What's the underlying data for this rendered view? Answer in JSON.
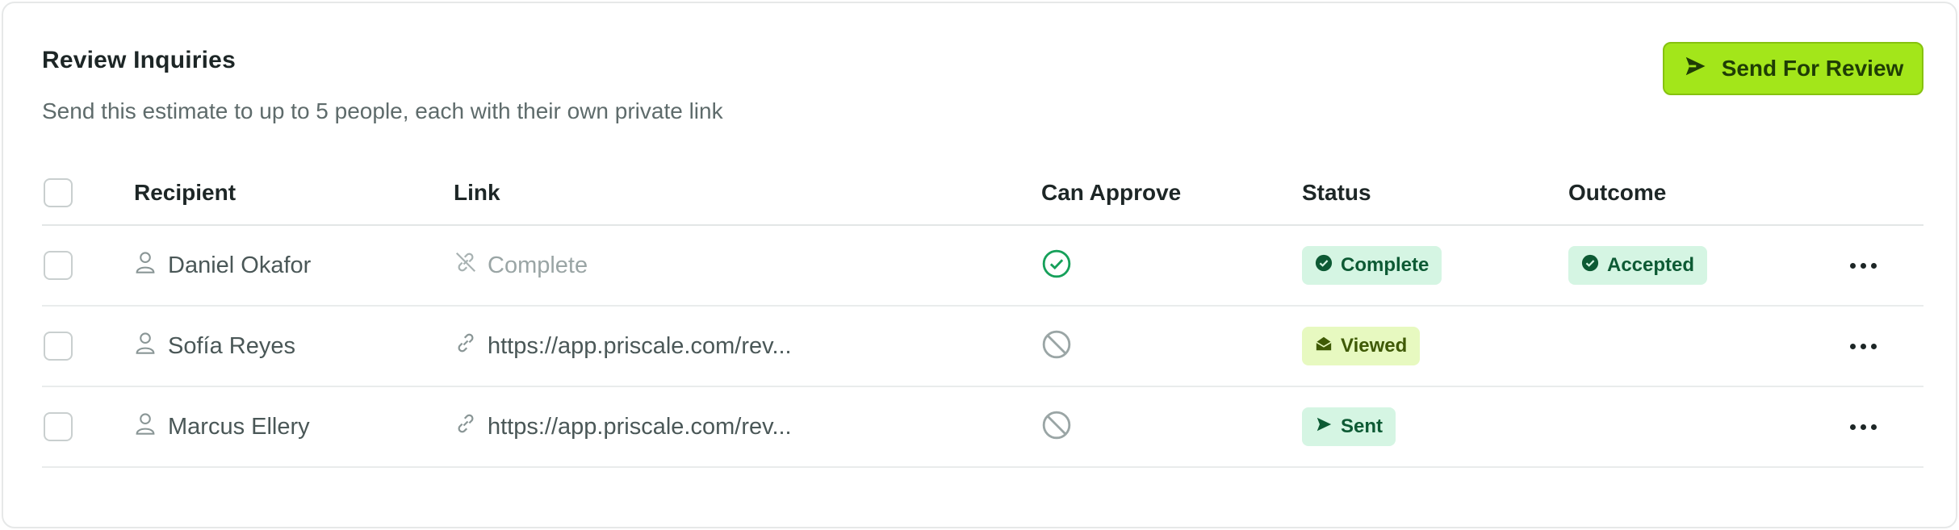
{
  "header": {
    "title": "Review Inquiries",
    "subtitle": "Send this estimate to up to 5 people, each with their own private link",
    "send_button_label": "Send For Review"
  },
  "table": {
    "columns": [
      "Recipient",
      "Link",
      "Can Approve",
      "Status",
      "Outcome"
    ],
    "rows": [
      {
        "recipient": "Daniel Okafor",
        "link": "Complete",
        "link_state": "disabled",
        "can_approve": true,
        "status": "Complete",
        "status_icon": "check-circle-icon",
        "outcome": "Accepted"
      },
      {
        "recipient": "Sofía Reyes",
        "link": "https://app.priscale.com/rev...",
        "link_state": "active",
        "can_approve": false,
        "status": "Viewed",
        "status_icon": "envelope-open-icon",
        "outcome": ""
      },
      {
        "recipient": "Marcus Ellery",
        "link": "https://app.priscale.com/rev...",
        "link_state": "active",
        "can_approve": false,
        "status": "Sent",
        "status_icon": "send-icon",
        "outcome": ""
      }
    ]
  },
  "colors": {
    "primary_button": "#a3e61a",
    "success_badge_bg": "#d5f5e3",
    "viewed_badge_bg": "#e7f9c0",
    "approve_check": "#16a05a"
  }
}
